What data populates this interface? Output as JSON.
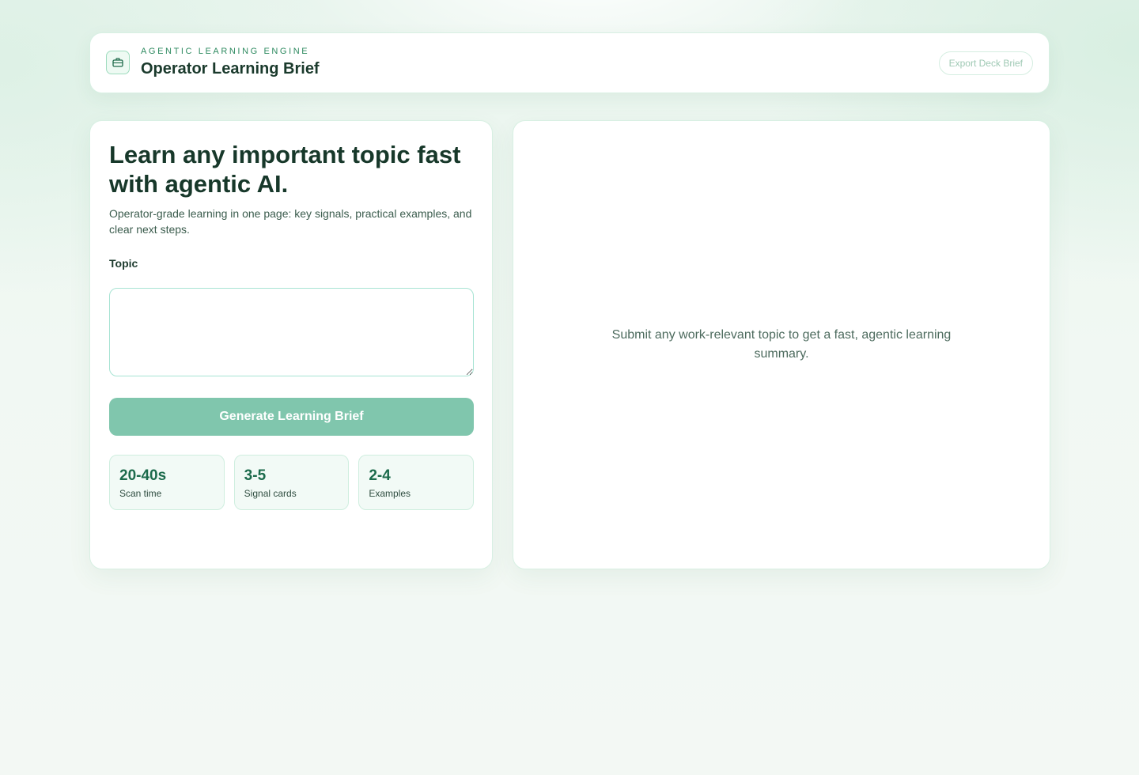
{
  "header": {
    "eyebrow": "AGENTIC LEARNING ENGINE",
    "title": "Operator Learning Brief",
    "export_label": "Export Deck Brief",
    "icon": "briefcase-icon"
  },
  "form": {
    "headline": "Learn any important topic fast with agentic AI.",
    "subline": "Operator-grade learning in one page: key signals, practical examples, and clear next steps.",
    "topic_label": "Topic",
    "topic_value": "",
    "generate_label": "Generate Learning Brief",
    "stats": [
      {
        "value": "20-40s",
        "label": "Scan time"
      },
      {
        "value": "3-5",
        "label": "Signal cards"
      },
      {
        "value": "2-4",
        "label": "Examples"
      }
    ]
  },
  "output": {
    "empty_message": "Submit any work-relevant topic to get a fast, agentic learning summary."
  },
  "colors": {
    "accent": "#2e8a60",
    "button_disabled": "#80c6ad",
    "stat_value": "#1c6b4c",
    "heading": "#17382a"
  }
}
